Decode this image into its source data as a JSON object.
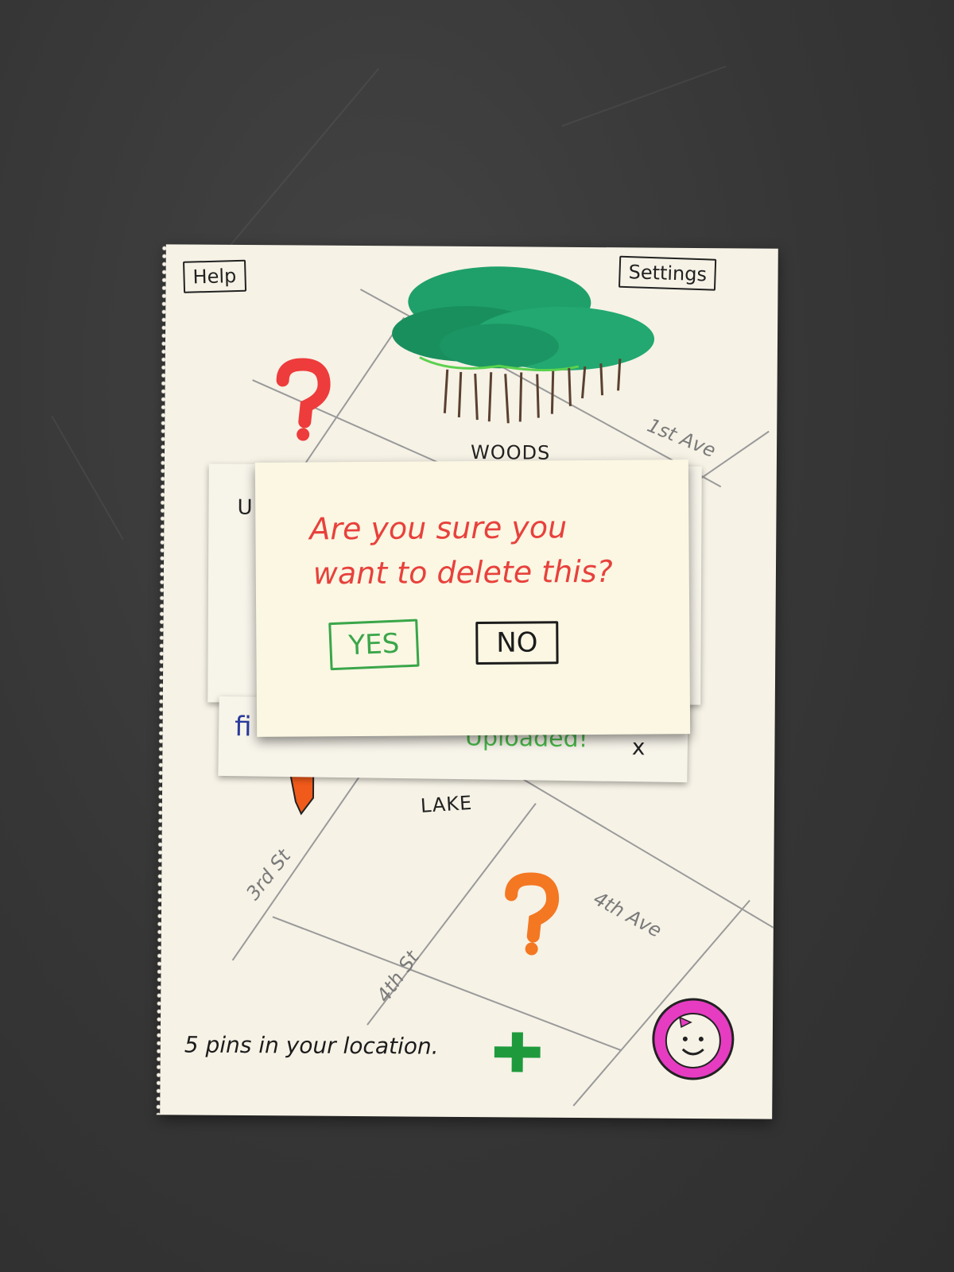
{
  "toolbar": {
    "help_label": "Help",
    "settings_label": "Settings"
  },
  "map": {
    "places": {
      "woods": "WOODS",
      "lake": "LAKE"
    },
    "streets": {
      "first_ave": "1st Ave",
      "third_st": "3rd St",
      "fourth_st": "4th St",
      "fourth_ave": "4th Ave"
    },
    "pins": [
      {
        "icon": "question-mark-icon",
        "color": "#ee3b3b"
      },
      {
        "icon": "question-mark-icon",
        "color": "#f47722"
      },
      {
        "icon": "pin-marker-icon",
        "color": "#f05a1a"
      }
    ]
  },
  "notification": {
    "fragment_left": "fi",
    "fragment_status": "Uploaded!",
    "close_label": "x"
  },
  "back_note": {
    "fragment": "U"
  },
  "dialog": {
    "message_line1": "Are you sure you",
    "message_line2": "want to delete this?",
    "yes_label": "YES",
    "no_label": "NO"
  },
  "footer": {
    "pin_count_text": "5 pins in your location.",
    "add_icon": "plus-icon",
    "avatar_icon": "smiley-avatar-icon"
  },
  "colors": {
    "woods_green": "#1fa06a",
    "dialog_red": "#e8413c",
    "yes_green": "#3aa64a",
    "avatar_pink": "#e63cc1"
  }
}
